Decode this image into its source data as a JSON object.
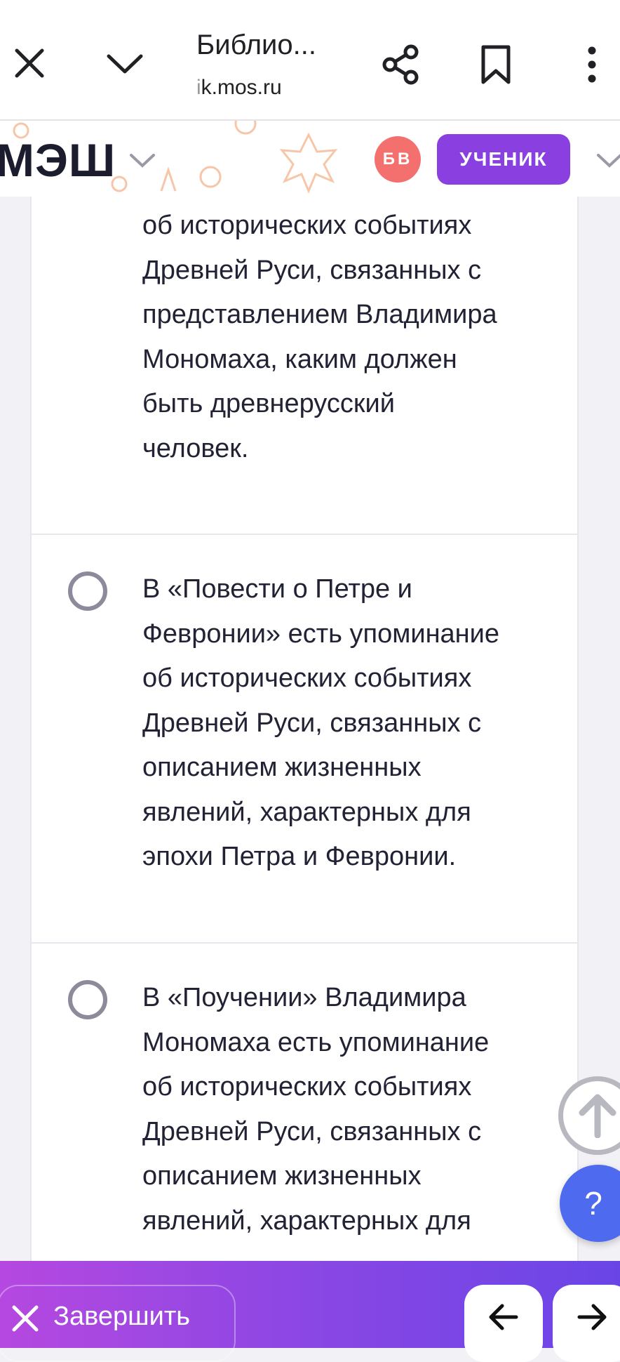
{
  "browser": {
    "title": "Библио...",
    "url_dim": "i",
    "url_main": "k.mos.ru"
  },
  "header": {
    "logo": "МЭШ",
    "avatar_initials": "БВ",
    "role_label": "УЧЕНИК"
  },
  "options": [
    {
      "text": "об исторических событиях\nДревней Руси, связанных с\nпредставлением Владимира\nМономаха, каким должен\nбыть древнерусский\nчеловек."
    },
    {
      "text": "В «Повести о Петре и\nФевронии» есть упоминание\nоб исторических событиях\nДревней Руси, связанных с\nописанием жизненных\nявлений, характерных для\nэпохи Петра и Февронии."
    },
    {
      "text": "В «Поучении» Владимира\nМономаха есть упоминание\nоб исторических событиях\nДревней Руси, связанных с\nописанием жизненных\nявлений, характерных для"
    }
  ],
  "help_label": "?",
  "bottom": {
    "finish_label": "Завершить"
  },
  "colors": {
    "accent": "#8a3fe0",
    "avatar": "#f4706e",
    "help": "#4e6bf0",
    "radio": "#8b8b9c"
  }
}
